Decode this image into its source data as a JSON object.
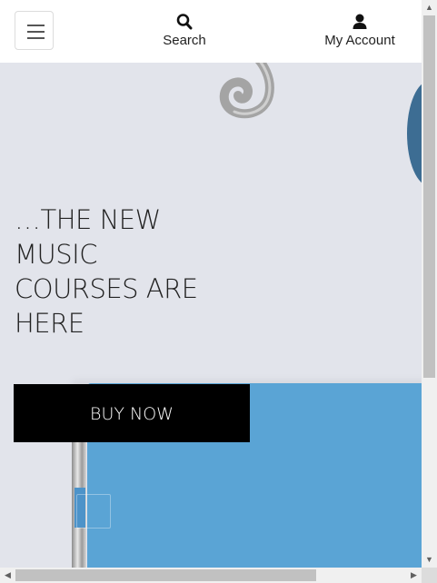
{
  "header": {
    "nav": [
      {
        "label": "Search",
        "icon": "search-icon"
      },
      {
        "label": "My Account",
        "icon": "user-icon"
      }
    ]
  },
  "hero": {
    "title_lines": [
      "…THE NEW",
      "MUSIC",
      "COURSES ARE",
      "HERE"
    ],
    "cta_label": "BUY NOW"
  },
  "colors": {
    "hero_bg": "#e2e4eb",
    "notebook": "#5aa4d5",
    "cta_bg": "#000000",
    "cta_text": "#ffffff"
  }
}
